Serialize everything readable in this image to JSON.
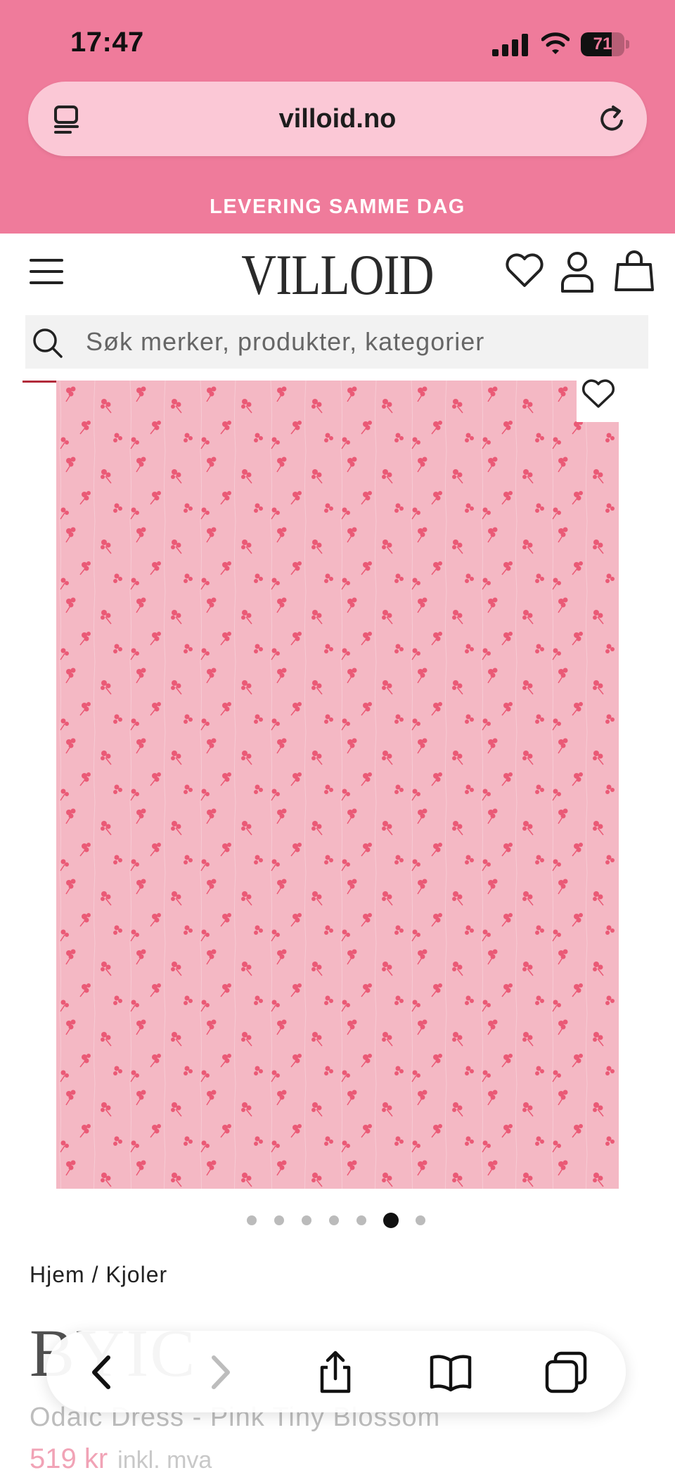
{
  "status_bar": {
    "time": "17:47",
    "battery": "71",
    "battery_level": 0.71
  },
  "browser": {
    "url": "villoid.no"
  },
  "promo": {
    "text": "LEVERING SAMME DAG"
  },
  "site": {
    "logo": "VILLOID"
  },
  "search": {
    "placeholder": "Søk merker, produkter, kategorier"
  },
  "gallery": {
    "dot_count": 7,
    "active_index": 5
  },
  "breadcrumb": "Hjem / Kjoler",
  "product": {
    "brand": "BYIC",
    "name": "Odalc Dress - Pink Tiny Blossom",
    "price": "519 kr",
    "price_note": "inkl. mva"
  },
  "colors": {
    "topbar": "#ef7b9b",
    "fabric": "#f4b8c4",
    "blossom": "#e94a68",
    "price": "#f1a3b6"
  },
  "icons": [
    "tab-icon",
    "reload-icon",
    "hamburger-icon",
    "heart-icon",
    "user-icon",
    "bag-icon",
    "search-icon",
    "back-icon",
    "forward-icon",
    "share-icon",
    "bookmarks-icon",
    "tabs-icon"
  ]
}
